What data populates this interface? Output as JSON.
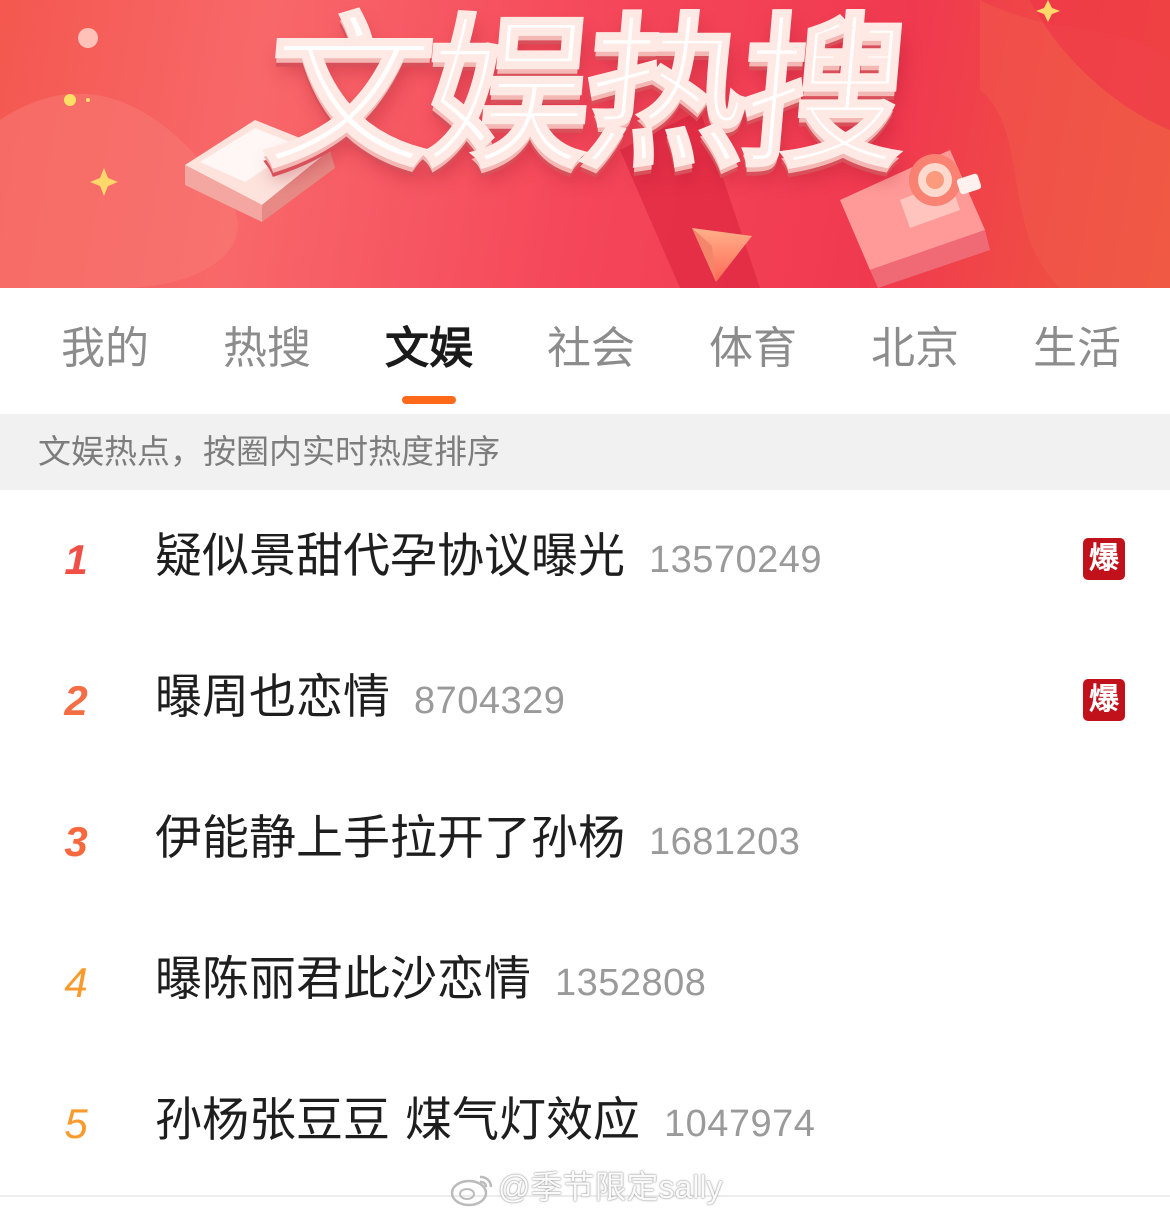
{
  "banner": {
    "title": "文娱热搜"
  },
  "tabs": [
    {
      "label": "我的",
      "active": false
    },
    {
      "label": "热搜",
      "active": false
    },
    {
      "label": "文娱",
      "active": true
    },
    {
      "label": "社会",
      "active": false
    },
    {
      "label": "体育",
      "active": false
    },
    {
      "label": "北京",
      "active": false
    },
    {
      "label": "生活",
      "active": false
    }
  ],
  "hint": "文娱热点，按圈内实时热度排序",
  "list": [
    {
      "rank": "1",
      "title": "疑似景甜代孕协议曝光",
      "count": "13570249",
      "badge": "爆"
    },
    {
      "rank": "2",
      "title": "曝周也恋情",
      "count": "8704329",
      "badge": "爆"
    },
    {
      "rank": "3",
      "title": "伊能静上手拉开了孙杨",
      "count": "1681203",
      "badge": ""
    },
    {
      "rank": "4",
      "title": "曝陈丽君此沙恋情",
      "count": "1352808",
      "badge": ""
    },
    {
      "rank": "5",
      "title": "孙杨张豆豆 煤气灯效应",
      "count": "1047974",
      "badge": ""
    }
  ],
  "colors": {
    "accent": "#ff6a1a",
    "rank_1": "#f14e45",
    "rank_2": "#f56d45",
    "rank_3": "#f7683f",
    "rank_4": "#fa9a2b",
    "rank_5": "#fa9a2b",
    "badge_bg": "#c1111b"
  },
  "watermark": "@季节限定sally"
}
